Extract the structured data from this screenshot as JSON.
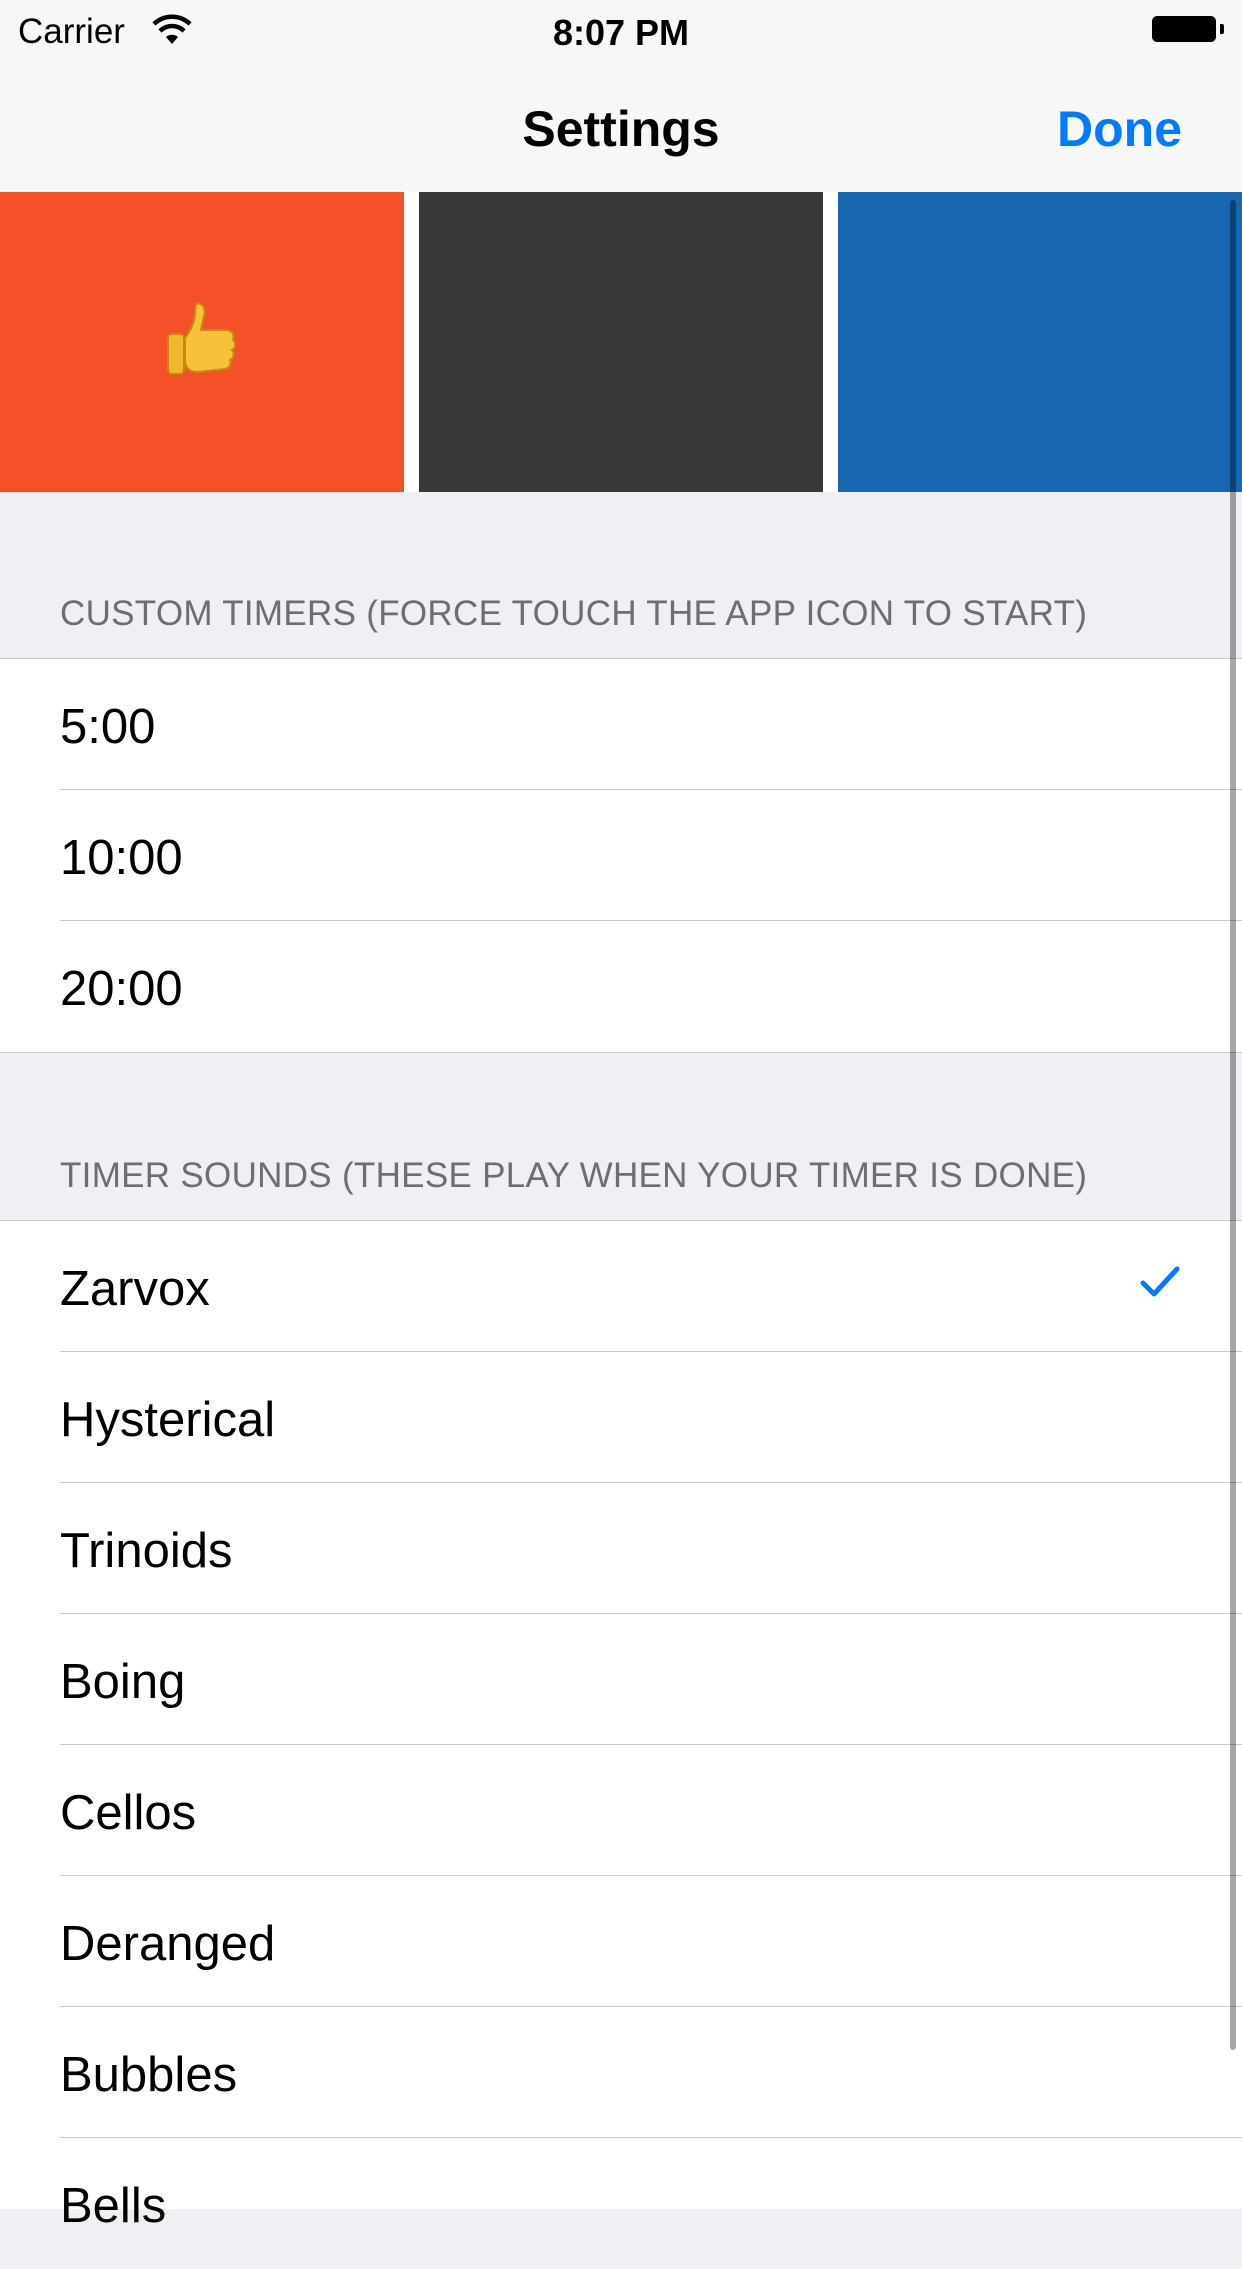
{
  "status_bar": {
    "carrier": "Carrier",
    "time": "8:07 PM",
    "icons": [
      "wifi-icon",
      "battery-icon"
    ]
  },
  "nav": {
    "title": "Settings",
    "done_label": "Done"
  },
  "themes": [
    {
      "color": "#f45128",
      "icon": "thumbs-up-icon"
    },
    {
      "color": "#393839"
    },
    {
      "color": "#1866b0"
    }
  ],
  "timers": {
    "header": "CUSTOM TIMERS (FORCE TOUCH THE APP ICON TO START)",
    "items": [
      {
        "label": "5:00"
      },
      {
        "label": "10:00"
      },
      {
        "label": "20:00"
      }
    ]
  },
  "sounds": {
    "header": "TIMER SOUNDS (THESE PLAY WHEN YOUR TIMER IS DONE)",
    "selected": "Zarvox",
    "items": [
      {
        "label": "Zarvox"
      },
      {
        "label": "Hysterical"
      },
      {
        "label": "Trinoids"
      },
      {
        "label": "Boing"
      },
      {
        "label": "Cellos"
      },
      {
        "label": "Deranged"
      },
      {
        "label": "Bubbles"
      },
      {
        "label": "Bells"
      }
    ]
  },
  "colors": {
    "accent": "#007aff",
    "section_bg": "#efeff4",
    "header_text": "#6d6d72",
    "separator": "#c8c7cc"
  }
}
